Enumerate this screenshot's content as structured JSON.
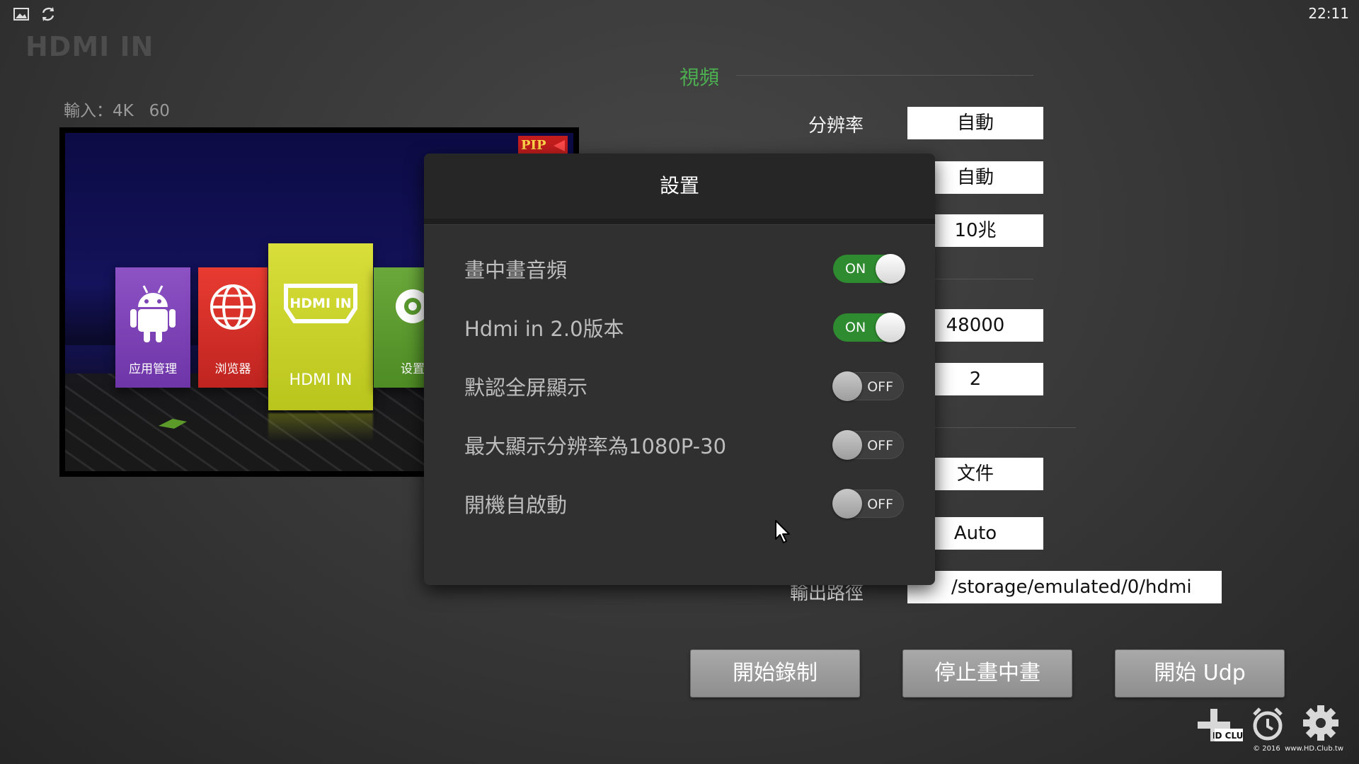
{
  "status_bar": {
    "clock": "22:11",
    "left_icons": [
      "gallery-icon",
      "sync-icon"
    ]
  },
  "app": {
    "title": "HDMI IN",
    "input_info": "輸入：4K   60"
  },
  "preview": {
    "pip_badge": "PIP",
    "tiles": [
      {
        "label": "应用管理",
        "icon": "android-icon"
      },
      {
        "label": "浏览器",
        "icon": "globe-icon"
      },
      {
        "label": "HDMI IN",
        "icon": "hdmi-icon",
        "logo": "HDMI IN"
      },
      {
        "label": "设置",
        "icon": "gear-icon"
      }
    ]
  },
  "form": {
    "section_video": "視頻",
    "resolution_label": "分辨率",
    "resolution_value": "自動",
    "field2_value": "自動",
    "bitrate_value": "10兆",
    "sample_rate_value": "48000",
    "channels_value": "2",
    "format_value": "文件",
    "mode_value": "Auto",
    "output_path_label": "輸出路徑",
    "output_path_value": "/storage/emulated/0/hdmi"
  },
  "actions": {
    "start_record": "開始錄制",
    "stop_pip": "停止畫中畫",
    "start_udp": "開始 Udp"
  },
  "dialog": {
    "title": "設置",
    "settings": [
      {
        "label": "畫中畫音頻",
        "state": "ON",
        "on": true
      },
      {
        "label": "Hdmi in 2.0版本",
        "state": "ON",
        "on": true
      },
      {
        "label": "默認全屏顯示",
        "state": "OFF",
        "on": false
      },
      {
        "label": "最大顯示分辨率為1080P-30",
        "state": "OFF",
        "on": false
      },
      {
        "label": "開機自啟動",
        "state": "OFF",
        "on": false
      }
    ]
  },
  "footer": {
    "copyright": "© 2016  www.HD.Club.tw",
    "logo_text": "HD CLUB",
    "icons": [
      "plus-icon",
      "alarm-clock-icon",
      "gear-icon"
    ]
  },
  "colors": {
    "accent_green": "#4caf50",
    "toggle_on": "#2e8b2f",
    "button_gray": "#9c9c9c",
    "dialog_bg": "#303030"
  }
}
